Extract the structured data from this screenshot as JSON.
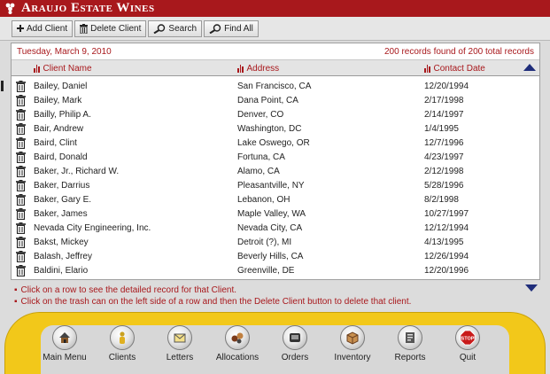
{
  "app": {
    "title": "Araujo Estate Wines"
  },
  "toolbar": {
    "add_client": "Add Client",
    "delete_client": "Delete Client",
    "search": "Search",
    "find_all": "Find All"
  },
  "info": {
    "date": "Tuesday, March 9, 2010",
    "records": "200 records found of 200 total records"
  },
  "columns": {
    "name": "Client Name",
    "address": "Address",
    "contact_date": "Contact Date"
  },
  "rows": [
    {
      "name": "Bailey, Daniel",
      "address": "San Francisco, CA",
      "date": "12/20/1994"
    },
    {
      "name": "Bailey, Mark",
      "address": "Dana Point, CA",
      "date": "2/17/1998"
    },
    {
      "name": "Bailly, Philip A.",
      "address": "Denver, CO",
      "date": "2/14/1997"
    },
    {
      "name": "Bair, Andrew",
      "address": "Washington, DC",
      "date": "1/4/1995"
    },
    {
      "name": "Baird, Clint",
      "address": "Lake Oswego, OR",
      "date": "12/7/1996"
    },
    {
      "name": "Baird, Donald",
      "address": "Fortuna, CA",
      "date": "4/23/1997"
    },
    {
      "name": "Baker, Jr., Richard W.",
      "address": "Alamo, CA",
      "date": "2/12/1998"
    },
    {
      "name": "Baker, Darrius",
      "address": "Pleasantville, NY",
      "date": "5/28/1996"
    },
    {
      "name": "Baker, Gary E.",
      "address": "Lebanon, OH",
      "date": "8/2/1998"
    },
    {
      "name": "Baker, James",
      "address": "Maple Valley, WA",
      "date": "10/27/1997"
    },
    {
      "name": "Nevada City Engineering, Inc.",
      "address": "Nevada City, CA",
      "date": "12/12/1994"
    },
    {
      "name": "Bakst, Mickey",
      "address": "Detroit (?), MI",
      "date": "4/13/1995"
    },
    {
      "name": "Balash, Jeffrey",
      "address": "Beverly Hills, CA",
      "date": "12/26/1994"
    },
    {
      "name": "Baldini, Elario",
      "address": "Greenville, DE",
      "date": "12/20/1996"
    }
  ],
  "hints": [
    "Click on a row to see the detailed record for that Client.",
    "Click on the trash can on the left side of a row and then the Delete Client button to delete that client."
  ],
  "dock": [
    {
      "label": "Main Menu",
      "icon": "house-icon"
    },
    {
      "label": "Clients",
      "icon": "person-icon"
    },
    {
      "label": "Letters",
      "icon": "letter-icon"
    },
    {
      "label": "Allocations",
      "icon": "allocations-icon"
    },
    {
      "label": "Orders",
      "icon": "orders-icon"
    },
    {
      "label": "Inventory",
      "icon": "inventory-box-icon"
    },
    {
      "label": "Reports",
      "icon": "reports-icon"
    },
    {
      "label": "Quit",
      "icon": "stop-sign-icon"
    }
  ],
  "colors": {
    "brand": "#a8181c",
    "dock": "#f2c81a",
    "sort_arrow": "#1f2d7a"
  }
}
